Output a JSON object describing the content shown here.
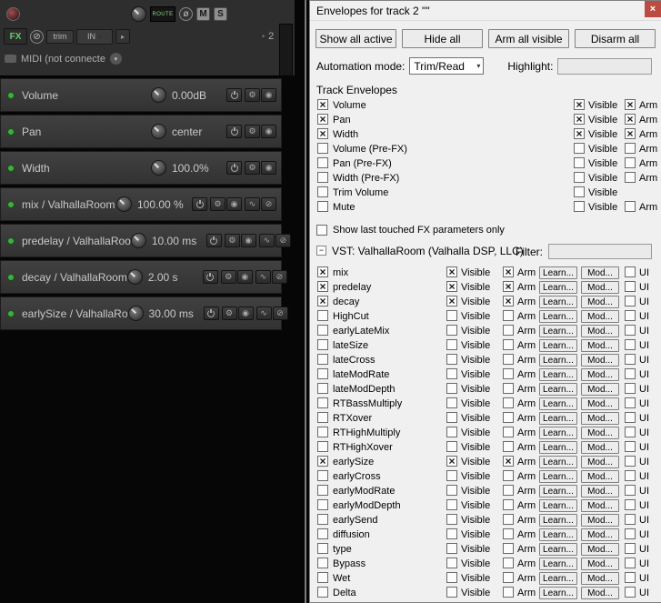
{
  "icons": {
    "close": "×",
    "check": "×",
    "dropdown": "▾",
    "collapse": "−",
    "phase": "ø",
    "gear": "⚙",
    "mode_dot": "◉",
    "sine": "∿",
    "bypass": "⊘",
    "arrow_right": "▸",
    "bullet": "•"
  },
  "left_panel": {
    "track_header": {
      "route_label": "ROUTE",
      "mute_label": "M",
      "solo_label": "S",
      "fx_label": "FX",
      "trim_label": "trim",
      "input_label": "IN",
      "midi_label": "MIDI (not connecte",
      "track_number": "2"
    },
    "lanes": [
      {
        "id": "volume",
        "name": "Volume",
        "value": "0.00dB",
        "fx": false
      },
      {
        "id": "pan",
        "name": "Pan",
        "value": "center",
        "fx": false
      },
      {
        "id": "width",
        "name": "Width",
        "value": "100.0%",
        "fx": false
      },
      {
        "id": "mix",
        "name": "mix / ValhallaRoom",
        "value": "100.00 %",
        "fx": true
      },
      {
        "id": "predelay",
        "name": "predelay / ValhallaRoo",
        "value": "10.00 ms",
        "fx": true
      },
      {
        "id": "decay",
        "name": "decay / ValhallaRoom",
        "value": "2.00 s",
        "fx": true
      },
      {
        "id": "earlysize",
        "name": "earlySize / ValhallaRo",
        "value": "30.00 ms",
        "fx": true
      }
    ]
  },
  "dialog": {
    "title": "Envelopes for track 2 \"\"",
    "top_buttons": [
      "Show all active",
      "Hide all",
      "Arm all visible",
      "Disarm all"
    ],
    "automation_mode_label": "Automation mode:",
    "automation_mode_value": "Trim/Read",
    "highlight_label": "Highlight:",
    "highlight_value": "",
    "track_envelopes_label": "Track Envelopes",
    "columns": {
      "visible": "Visible",
      "arm": "Arm",
      "ui": "UI",
      "learn": "Learn...",
      "mod": "Mod..."
    },
    "track_envelopes": [
      {
        "name": "Volume",
        "active": true,
        "visible": true,
        "arm": true,
        "has_arm": true
      },
      {
        "name": "Pan",
        "active": true,
        "visible": true,
        "arm": true,
        "has_arm": true
      },
      {
        "name": "Width",
        "active": true,
        "visible": true,
        "arm": true,
        "has_arm": true
      },
      {
        "name": "Volume (Pre-FX)",
        "active": false,
        "visible": false,
        "arm": false,
        "has_arm": true
      },
      {
        "name": "Pan (Pre-FX)",
        "active": false,
        "visible": false,
        "arm": false,
        "has_arm": true
      },
      {
        "name": "Width (Pre-FX)",
        "active": false,
        "visible": false,
        "arm": false,
        "has_arm": true
      },
      {
        "name": "Trim Volume",
        "active": false,
        "visible": false,
        "arm": false,
        "has_arm": false
      },
      {
        "name": "Mute",
        "active": false,
        "visible": false,
        "arm": false,
        "has_arm": true
      }
    ],
    "show_last_touched_label": "Show last touched FX parameters only",
    "show_last_touched_checked": false,
    "fx_section": {
      "title": "VST: ValhallaRoom (Valhalla DSP, LLC)",
      "filter_label": "Filter:",
      "filter_value": "",
      "params": [
        {
          "name": "mix",
          "active": true,
          "visible": true,
          "arm": true,
          "ui": false
        },
        {
          "name": "predelay",
          "active": true,
          "visible": true,
          "arm": true,
          "ui": false
        },
        {
          "name": "decay",
          "active": true,
          "visible": true,
          "arm": true,
          "ui": false
        },
        {
          "name": "HighCut",
          "active": false,
          "visible": false,
          "arm": false,
          "ui": false
        },
        {
          "name": "earlyLateMix",
          "active": false,
          "visible": false,
          "arm": false,
          "ui": false
        },
        {
          "name": "lateSize",
          "active": false,
          "visible": false,
          "arm": false,
          "ui": false
        },
        {
          "name": "lateCross",
          "active": false,
          "visible": false,
          "arm": false,
          "ui": false
        },
        {
          "name": "lateModRate",
          "active": false,
          "visible": false,
          "arm": false,
          "ui": false
        },
        {
          "name": "lateModDepth",
          "active": false,
          "visible": false,
          "arm": false,
          "ui": false
        },
        {
          "name": "RTBassMultiply",
          "active": false,
          "visible": false,
          "arm": false,
          "ui": false
        },
        {
          "name": "RTXover",
          "active": false,
          "visible": false,
          "arm": false,
          "ui": false
        },
        {
          "name": "RTHighMultiply",
          "active": false,
          "visible": false,
          "arm": false,
          "ui": false
        },
        {
          "name": "RTHighXover",
          "active": false,
          "visible": false,
          "arm": false,
          "ui": false
        },
        {
          "name": "earlySize",
          "active": true,
          "visible": true,
          "arm": true,
          "ui": false
        },
        {
          "name": "earlyCross",
          "active": false,
          "visible": false,
          "arm": false,
          "ui": false
        },
        {
          "name": "earlyModRate",
          "active": false,
          "visible": false,
          "arm": false,
          "ui": false
        },
        {
          "name": "earlyModDepth",
          "active": false,
          "visible": false,
          "arm": false,
          "ui": false
        },
        {
          "name": "earlySend",
          "active": false,
          "visible": false,
          "arm": false,
          "ui": false
        },
        {
          "name": "diffusion",
          "active": false,
          "visible": false,
          "arm": false,
          "ui": false
        },
        {
          "name": "type",
          "active": false,
          "visible": false,
          "arm": false,
          "ui": false
        },
        {
          "name": "Bypass",
          "active": false,
          "visible": false,
          "arm": false,
          "ui": false
        },
        {
          "name": "Wet",
          "active": false,
          "visible": false,
          "arm": false,
          "ui": false
        },
        {
          "name": "Delta",
          "active": false,
          "visible": false,
          "arm": false,
          "ui": false
        }
      ]
    }
  },
  "colors": {
    "accent_green": "#3fae3f",
    "close_red": "#bc4b42",
    "dialog_bg": "#f0f0f0",
    "panel_bg": "#2e2e2e"
  }
}
